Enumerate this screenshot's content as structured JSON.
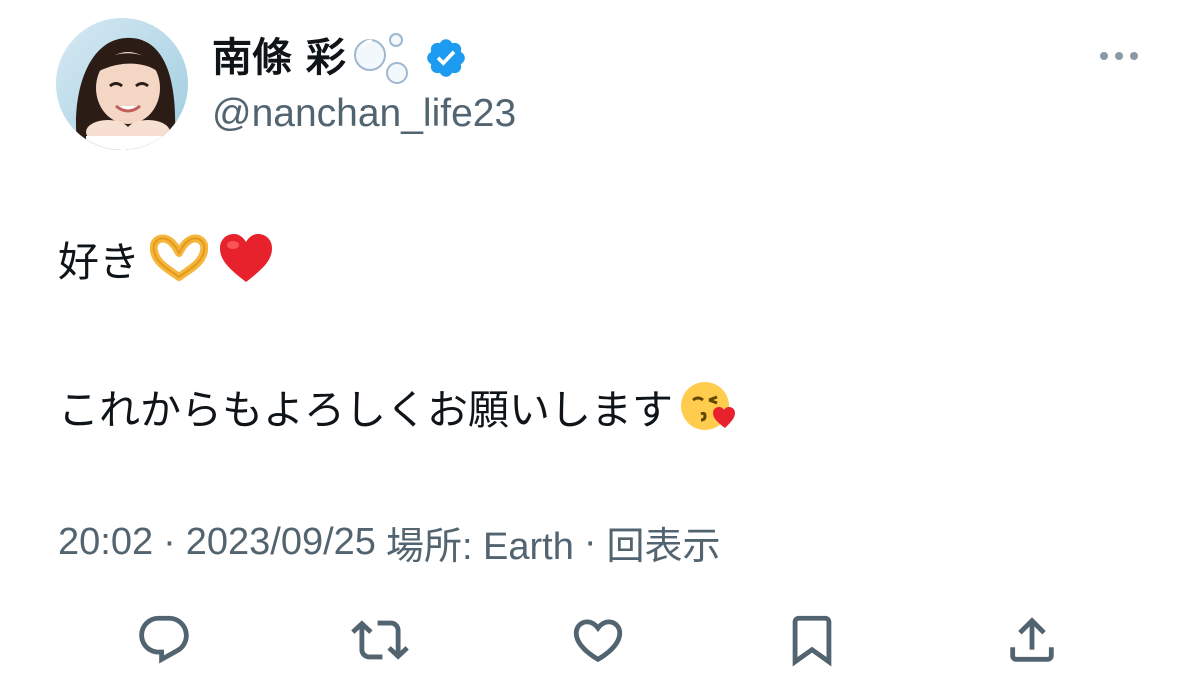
{
  "user": {
    "display_name": "南條 彩",
    "handle": "@nanchan_life23",
    "verified": true,
    "avatar_icon": "profile-photo",
    "name_decoration_icon": "bubbles-icon"
  },
  "tweet": {
    "line1_text": "好き",
    "line1_emojis": [
      "heart-hands-emoji",
      "red-heart-emoji"
    ],
    "line2_text": "これからもよろしくお願いします",
    "line2_emojis": [
      "face-blowing-kiss-emoji"
    ]
  },
  "meta": {
    "time": "20:02",
    "separator": "·",
    "date": "2023/09/25",
    "location": "場所: Earth",
    "views": "回表示"
  },
  "actions": [
    {
      "name": "reply",
      "icon": "reply-icon"
    },
    {
      "name": "retweet",
      "icon": "retweet-icon"
    },
    {
      "name": "like",
      "icon": "heart-icon"
    },
    {
      "name": "bookmark",
      "icon": "bookmark-icon"
    },
    {
      "name": "share",
      "icon": "share-icon"
    }
  ],
  "colors": {
    "text_primary": "#0f1419",
    "text_secondary": "#536471",
    "verified_blue": "#1d9bf0",
    "icon_gray": "#536471",
    "heart_red": "#e0245e"
  }
}
